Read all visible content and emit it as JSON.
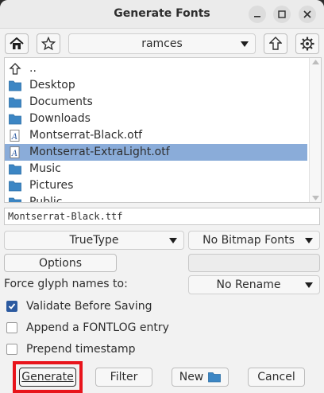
{
  "window": {
    "title": "Generate Fonts"
  },
  "toolbar": {
    "location": "ramces"
  },
  "files": [
    {
      "name": "..",
      "type": "parent"
    },
    {
      "name": "Desktop",
      "type": "folder"
    },
    {
      "name": "Documents",
      "type": "folder"
    },
    {
      "name": "Downloads",
      "type": "folder"
    },
    {
      "name": "Montserrat-Black.otf",
      "type": "font"
    },
    {
      "name": "Montserrat-ExtraLight.otf",
      "type": "font",
      "selected": true
    },
    {
      "name": "Music",
      "type": "folder"
    },
    {
      "name": "Pictures",
      "type": "folder"
    },
    {
      "name": "Public",
      "type": "folder"
    }
  ],
  "filename": {
    "value": "Montserrat-Black.ttf"
  },
  "format": {
    "font_type": "TrueType",
    "bitmap": "No Bitmap Fonts"
  },
  "options": {
    "label": "Options"
  },
  "glyph_names": {
    "label": "Force glyph names to:",
    "value": "No Rename"
  },
  "checks": {
    "validate": {
      "label": "Validate Before Saving",
      "checked": true
    },
    "fontlog": {
      "label": "Append a FONTLOG entry",
      "checked": false
    },
    "timestamp": {
      "label": "Prepend timestamp",
      "checked": false
    }
  },
  "buttons": {
    "generate": "Generate",
    "filter": "Filter",
    "new": "New",
    "cancel": "Cancel"
  },
  "colors": {
    "selection": "#8aacd9",
    "checkbox_checked": "#2c5aa0",
    "highlight_box": "#e8141b"
  }
}
